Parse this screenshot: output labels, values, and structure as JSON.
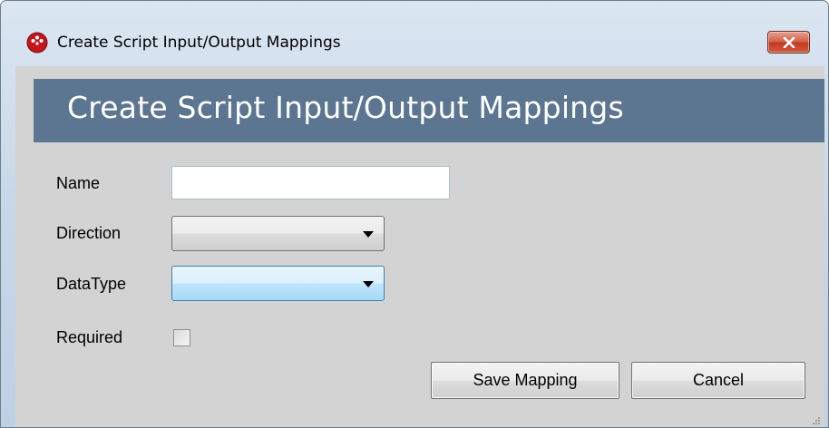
{
  "window": {
    "title": "Create Script Input/Output Mappings",
    "icon": "meridium-app-icon",
    "close_icon": "close-icon"
  },
  "header": {
    "title": "Create Script Input/Output Mappings",
    "background_color": "#5c7591"
  },
  "form": {
    "name": {
      "label": "Name",
      "value": ""
    },
    "direction": {
      "label": "Direction",
      "value": ""
    },
    "datatype": {
      "label": "DataType",
      "value": ""
    },
    "required": {
      "label": "Required",
      "checked": false
    }
  },
  "buttons": {
    "save_label": "Save Mapping",
    "cancel_label": "Cancel"
  }
}
